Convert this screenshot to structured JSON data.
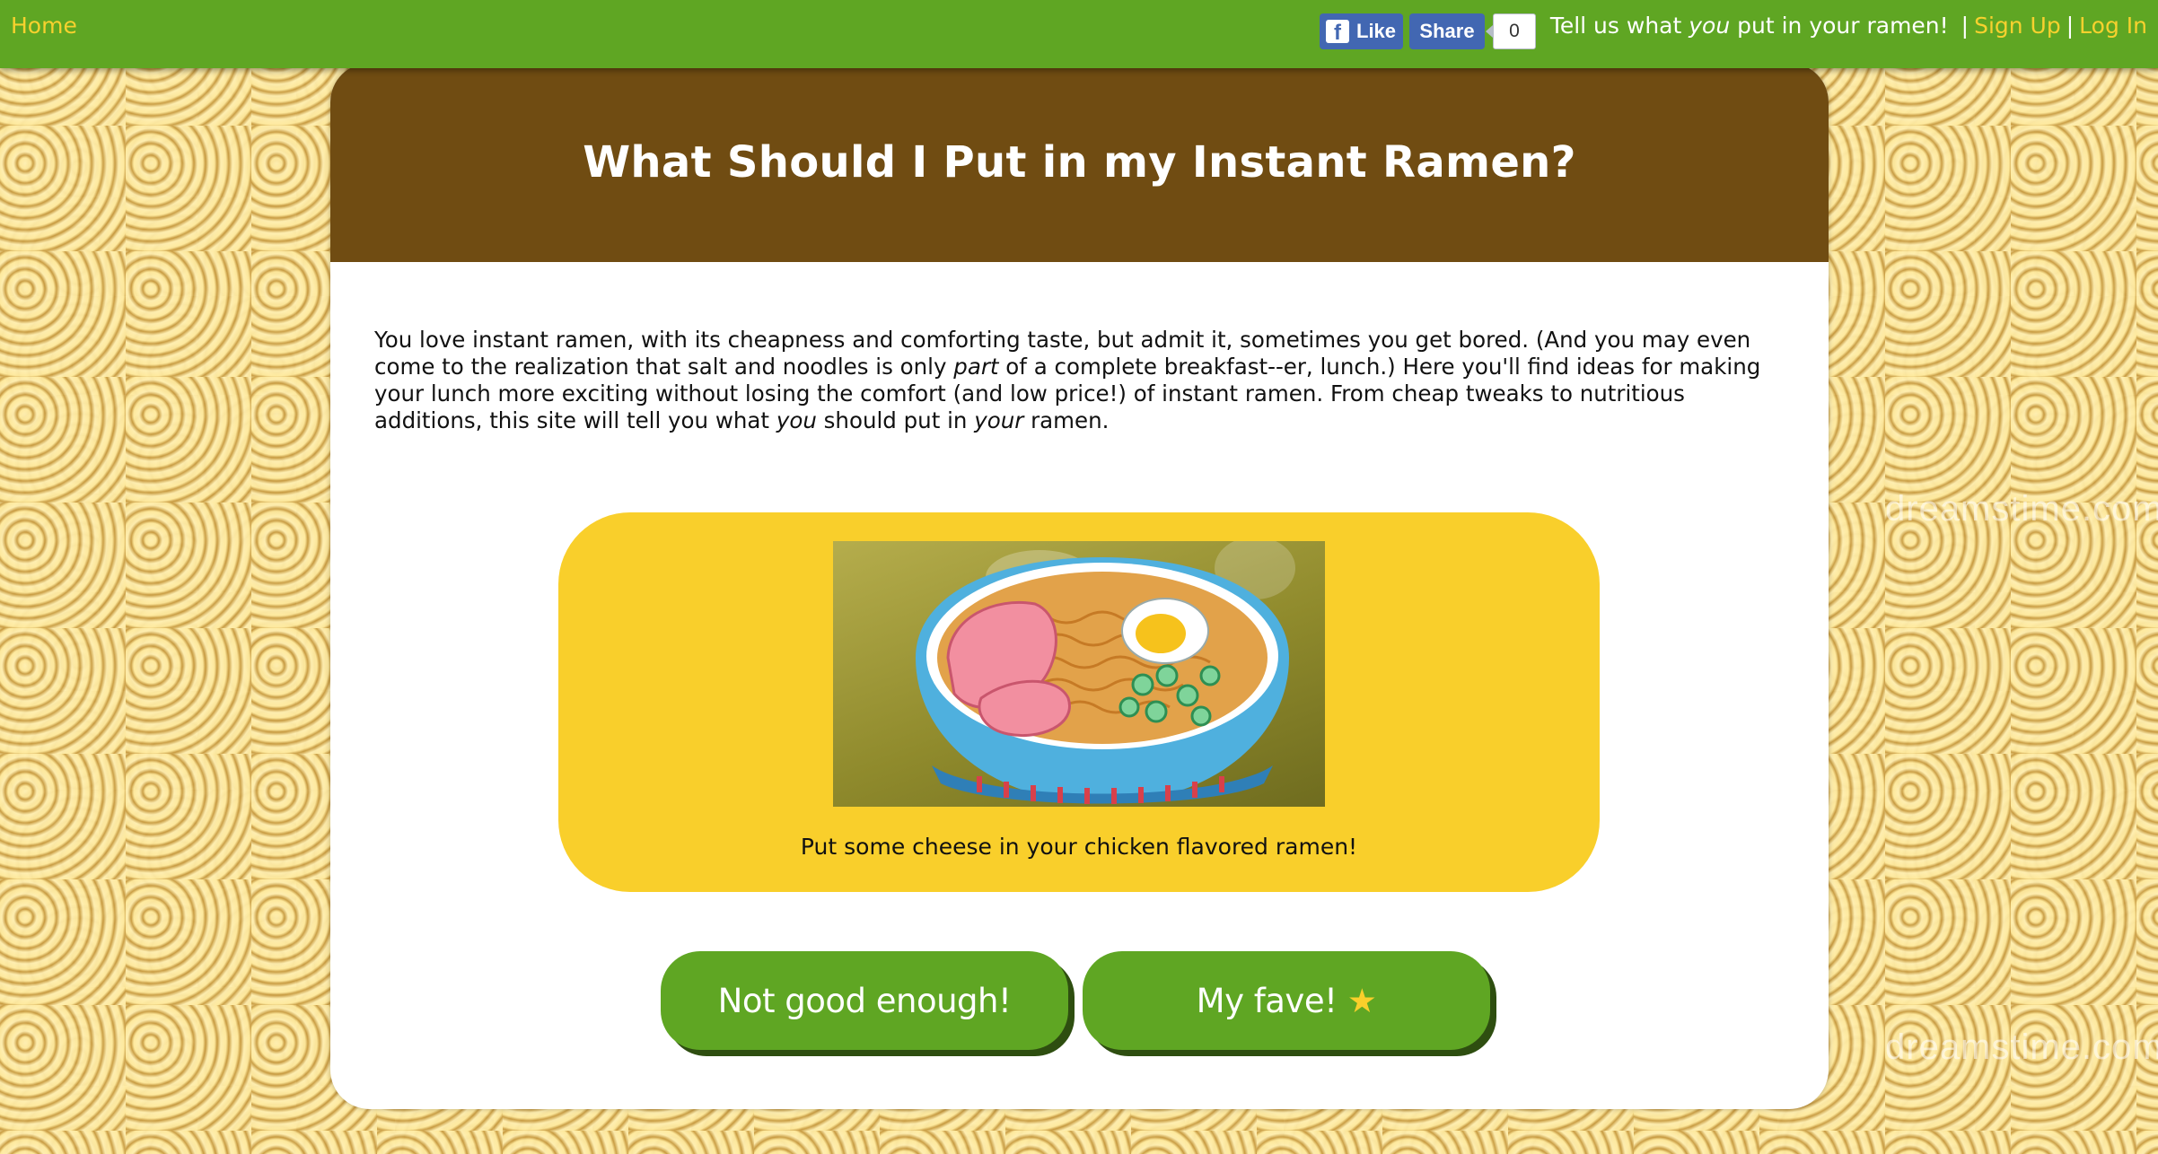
{
  "nav": {
    "home": "Home",
    "fb_like": "Like",
    "fb_share": "Share",
    "fb_count": "0",
    "tagline_pre": "Tell us what ",
    "tagline_em": "you",
    "tagline_post": " put in your ramen!",
    "separator": "|",
    "sign_up": "Sign Up",
    "log_in": "Log In"
  },
  "header": {
    "title": "What Should I Put in my Instant Ramen?"
  },
  "intro": {
    "p1": "You love instant ramen, with its cheapness and comforting taste, but admit it, sometimes you get bored. (And you may even come to the realization that salt and noodles is only ",
    "em1": "part",
    "p2": " of a complete breakfast--er, lunch.) Here you'll find ideas for making your lunch more exciting without losing the comfort (and low price!) of instant ramen. From cheap tweaks to nutritious additions, this site will tell you what ",
    "em2": "you",
    "p3": " should put in ",
    "em3": "your",
    "p4": " ramen."
  },
  "suggestion": {
    "image_icon": "ramen-bowl-illustration",
    "caption": "Put some cheese in your chicken flavored ramen!"
  },
  "buttons": {
    "not_good": "Not good enough!",
    "fave": "My fave!",
    "fave_star": "★"
  },
  "background": {
    "watermark": "dreamstime.com"
  },
  "colors": {
    "bar_green": "#5fa623",
    "link_yellow": "#f7d12e",
    "header_brown": "#704c12",
    "suggestion_yellow": "#f9cf2b",
    "fb_blue": "#4267b2"
  }
}
